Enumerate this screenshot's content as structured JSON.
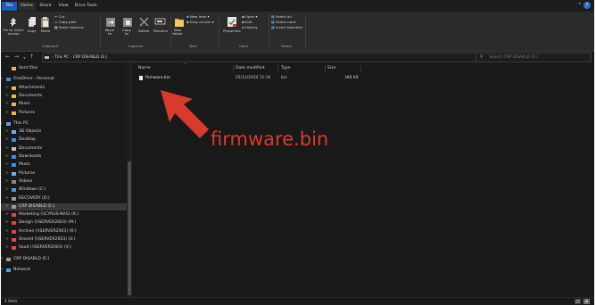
{
  "ribbon_tabs": [
    "File",
    "Home",
    "Share",
    "View",
    "Drive Tools"
  ],
  "clipboard": {
    "pin": "Pin to Quick\naccess",
    "copy": "Copy",
    "paste": "Paste",
    "cut": "Cut",
    "copy_path": "Copy path",
    "paste_shortcut": "Paste shortcut",
    "label": "Clipboard"
  },
  "organize": {
    "move_to": "Move\nto",
    "copy_to": "Copy\nto",
    "delete": "Delete",
    "rename": "Rename",
    "label": "Organize"
  },
  "new_group": {
    "new_folder": "New\nfolder",
    "new_item": "New item",
    "easy_access": "Easy access",
    "label": "New"
  },
  "open_group": {
    "properties": "Properties",
    "open": "Open",
    "edit": "Edit",
    "history": "History",
    "label": "Open"
  },
  "select_group": {
    "select_all": "Select all",
    "select_none": "Select none",
    "invert": "Invert selection",
    "label": "Select"
  },
  "address": {
    "path": [
      "This PC",
      "CRP DISABLD (E:)"
    ],
    "search_placeholder": "Search CRP DISABLD (E:)"
  },
  "nav_items": [
    {
      "label": "Sent files",
      "color": "#e8b84a",
      "indent": 1,
      "chev": ""
    },
    {
      "label": "OneDrive - Personal",
      "color": "#3a8ee6",
      "indent": 0,
      "chev": "v"
    },
    {
      "label": "Attachments",
      "color": "#e8b84a",
      "indent": 1,
      "chev": ">"
    },
    {
      "label": "Documents",
      "color": "#e8b84a",
      "indent": 1,
      "chev": ">"
    },
    {
      "label": "Music",
      "color": "#e8b84a",
      "indent": 1,
      "chev": ">"
    },
    {
      "label": "Pictures",
      "color": "#e8b84a",
      "indent": 1,
      "chev": ">"
    },
    {
      "label": "This PC",
      "color": "#5aa0e6",
      "indent": 0,
      "chev": "v"
    },
    {
      "label": "3D Objects",
      "color": "#6fb3f0",
      "indent": 1,
      "chev": ">"
    },
    {
      "label": "Desktop",
      "color": "#3f8fe0",
      "indent": 1,
      "chev": ">"
    },
    {
      "label": "Documents",
      "color": "#bfbfbf",
      "indent": 1,
      "chev": ">"
    },
    {
      "label": "Downloads",
      "color": "#3f8fe0",
      "indent": 1,
      "chev": ">"
    },
    {
      "label": "Music",
      "color": "#3f8fe0",
      "indent": 1,
      "chev": ">"
    },
    {
      "label": "Pictures",
      "color": "#6fb3f0",
      "indent": 1,
      "chev": ">"
    },
    {
      "label": "Videos",
      "color": "#8a8a8a",
      "indent": 1,
      "chev": ">"
    },
    {
      "label": "Windows (C:)",
      "color": "#4a9be8",
      "indent": 1,
      "chev": ">"
    },
    {
      "label": "RECOVERY (D:)",
      "color": "#9a9a9a",
      "indent": 1,
      "chev": ">"
    },
    {
      "label": "CRP DISABLD (E:)",
      "color": "#9a9a9a",
      "indent": 1,
      "chev": ">",
      "selected": true
    },
    {
      "label": "Marketing (\\\\CYRUS-NAS) (K:)",
      "color": "#d84a3a",
      "indent": 1,
      "chev": ">"
    },
    {
      "label": "Design (\\\\SERVER2003) (M:)",
      "color": "#d84a3a",
      "indent": 1,
      "chev": ">"
    },
    {
      "label": "Archive (\\\\SERVER2003) (R:)",
      "color": "#d84a3a",
      "indent": 1,
      "chev": ">"
    },
    {
      "label": "Shared (\\\\SERVER2003) (S:)",
      "color": "#d84a3a",
      "indent": 1,
      "chev": ">"
    },
    {
      "label": "Vault (\\\\SERVER2003) (V:)",
      "color": "#d84a3a",
      "indent": 1,
      "chev": ">"
    },
    {
      "label": "CRP DISABLD (E:)",
      "color": "#9a9a9a",
      "indent": 0,
      "chev": ">"
    },
    {
      "label": "Network",
      "color": "#4a9be8",
      "indent": 0,
      "chev": ">"
    }
  ],
  "columns": {
    "name": "Name",
    "date": "Date modified",
    "type": "Type",
    "size": "Size"
  },
  "files": [
    {
      "name": "firmware.bin",
      "date": "25/12/2020 11:10",
      "type": "bin",
      "size": "388 KB"
    }
  ],
  "callout": "firmware.bin",
  "status": "1 item",
  "colors": {
    "accent": "#1a5fb4",
    "callout": "#d83b2c",
    "background": "#191919"
  }
}
